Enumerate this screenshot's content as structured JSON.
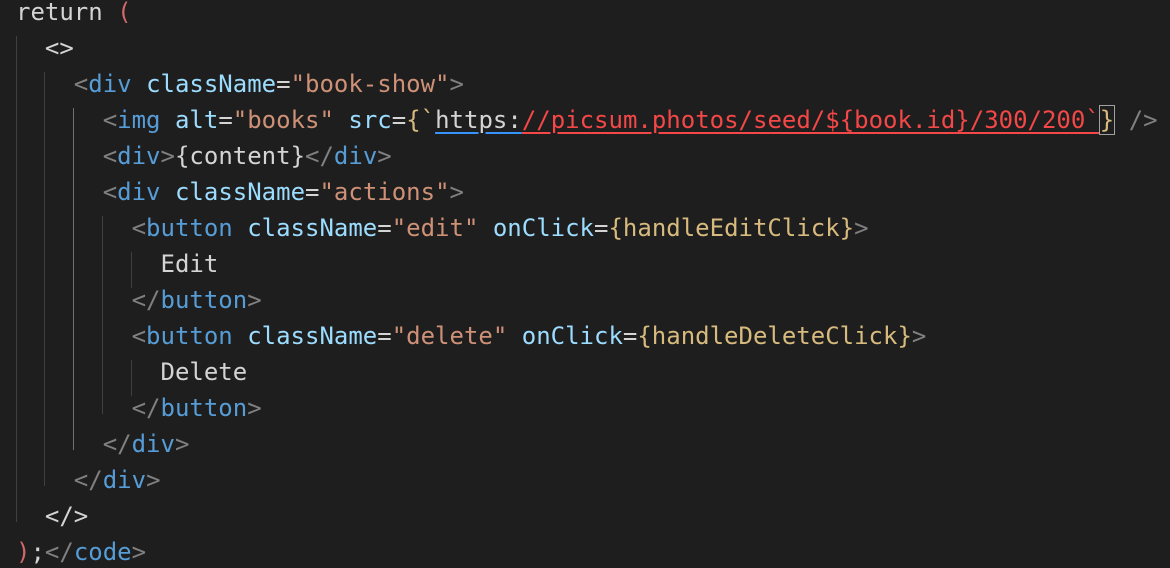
{
  "editor": {
    "lines": [
      {
        "parts": [
          {
            "t": "return",
            "c": "t-kw"
          },
          {
            "t": " ",
            "c": ""
          },
          {
            "t": "(",
            "c": "t-paren"
          }
        ]
      },
      {
        "parts": [
          {
            "t": "  ",
            "c": ""
          },
          {
            "t": "<>",
            "c": "t-ident"
          }
        ]
      },
      {
        "parts": [
          {
            "t": "    ",
            "c": ""
          },
          {
            "t": "<",
            "c": "t-punct"
          },
          {
            "t": "div",
            "c": "t-tag"
          },
          {
            "t": " ",
            "c": ""
          },
          {
            "t": "className",
            "c": "t-attr"
          },
          {
            "t": "=",
            "c": "t-ident"
          },
          {
            "t": "\"book-show\"",
            "c": "t-str"
          },
          {
            "t": ">",
            "c": "t-punct"
          }
        ]
      },
      {
        "parts": [
          {
            "t": "      ",
            "c": ""
          },
          {
            "t": "<",
            "c": "t-punct"
          },
          {
            "t": "img",
            "c": "t-tag"
          },
          {
            "t": " ",
            "c": ""
          },
          {
            "t": "alt",
            "c": "t-attr"
          },
          {
            "t": "=",
            "c": "t-ident"
          },
          {
            "t": "\"books\"",
            "c": "t-str"
          },
          {
            "t": " ",
            "c": ""
          },
          {
            "t": "src",
            "c": "t-attr"
          },
          {
            "t": "=",
            "c": "t-ident"
          },
          {
            "t": "{`",
            "c": "t-brace"
          },
          {
            "t": "https:",
            "c": "t-url"
          },
          {
            "t": "//picsum.photos/seed/${book.id}/300/200`",
            "c": "t-tmpl"
          },
          {
            "t": "}",
            "c": "t-bracket-match"
          },
          {
            "t": " ",
            "c": ""
          },
          {
            "t": "/>",
            "c": "t-punct"
          }
        ]
      },
      {
        "parts": [
          {
            "t": "      ",
            "c": ""
          },
          {
            "t": "<",
            "c": "t-punct"
          },
          {
            "t": "div",
            "c": "t-tag"
          },
          {
            "t": ">",
            "c": "t-punct"
          },
          {
            "t": "{content}",
            "c": "t-text"
          },
          {
            "t": "</",
            "c": "t-punct"
          },
          {
            "t": "div",
            "c": "t-tag"
          },
          {
            "t": ">",
            "c": "t-punct"
          }
        ]
      },
      {
        "parts": [
          {
            "t": "      ",
            "c": ""
          },
          {
            "t": "<",
            "c": "t-punct"
          },
          {
            "t": "div",
            "c": "t-tag"
          },
          {
            "t": " ",
            "c": ""
          },
          {
            "t": "className",
            "c": "t-attr"
          },
          {
            "t": "=",
            "c": "t-ident"
          },
          {
            "t": "\"actions\"",
            "c": "t-str"
          },
          {
            "t": ">",
            "c": "t-punct"
          }
        ]
      },
      {
        "parts": [
          {
            "t": "        ",
            "c": ""
          },
          {
            "t": "<",
            "c": "t-punct"
          },
          {
            "t": "button",
            "c": "t-tag"
          },
          {
            "t": " ",
            "c": ""
          },
          {
            "t": "className",
            "c": "t-attr"
          },
          {
            "t": "=",
            "c": "t-ident"
          },
          {
            "t": "\"edit\"",
            "c": "t-str"
          },
          {
            "t": " ",
            "c": ""
          },
          {
            "t": "onClick",
            "c": "t-attr"
          },
          {
            "t": "=",
            "c": "t-ident"
          },
          {
            "t": "{handleEditClick}",
            "c": "t-brace"
          },
          {
            "t": ">",
            "c": "t-punct"
          }
        ]
      },
      {
        "parts": [
          {
            "t": "          ",
            "c": ""
          },
          {
            "t": "Edit",
            "c": "t-text"
          }
        ]
      },
      {
        "parts": [
          {
            "t": "        ",
            "c": ""
          },
          {
            "t": "</",
            "c": "t-punct"
          },
          {
            "t": "button",
            "c": "t-tag"
          },
          {
            "t": ">",
            "c": "t-punct"
          }
        ]
      },
      {
        "parts": [
          {
            "t": "        ",
            "c": ""
          },
          {
            "t": "<",
            "c": "t-punct"
          },
          {
            "t": "button",
            "c": "t-tag"
          },
          {
            "t": " ",
            "c": ""
          },
          {
            "t": "className",
            "c": "t-attr"
          },
          {
            "t": "=",
            "c": "t-ident"
          },
          {
            "t": "\"delete\"",
            "c": "t-str"
          },
          {
            "t": " ",
            "c": ""
          },
          {
            "t": "onClick",
            "c": "t-attr"
          },
          {
            "t": "=",
            "c": "t-ident"
          },
          {
            "t": "{handleDeleteClick}",
            "c": "t-brace"
          },
          {
            "t": ">",
            "c": "t-punct"
          }
        ]
      },
      {
        "parts": [
          {
            "t": "          ",
            "c": ""
          },
          {
            "t": "Delete",
            "c": "t-text"
          }
        ]
      },
      {
        "parts": [
          {
            "t": "        ",
            "c": ""
          },
          {
            "t": "</",
            "c": "t-punct"
          },
          {
            "t": "button",
            "c": "t-tag"
          },
          {
            "t": ">",
            "c": "t-punct"
          }
        ]
      },
      {
        "parts": [
          {
            "t": "      ",
            "c": ""
          },
          {
            "t": "</",
            "c": "t-punct"
          },
          {
            "t": "div",
            "c": "t-tag"
          },
          {
            "t": ">",
            "c": "t-punct"
          }
        ]
      },
      {
        "parts": [
          {
            "t": "    ",
            "c": ""
          },
          {
            "t": "</",
            "c": "t-punct"
          },
          {
            "t": "div",
            "c": "t-tag"
          },
          {
            "t": ">",
            "c": "t-punct"
          }
        ]
      },
      {
        "parts": [
          {
            "t": "  ",
            "c": ""
          },
          {
            "t": "</>",
            "c": "t-ident"
          }
        ]
      },
      {
        "parts": [
          {
            "t": ")",
            "c": "t-paren"
          },
          {
            "t": ";",
            "c": "t-ident"
          },
          {
            "t": "</",
            "c": "t-punct"
          },
          {
            "t": "code",
            "c": "t-tag"
          },
          {
            "t": ">",
            "c": "t-punct"
          }
        ]
      }
    ]
  },
  "colors": {
    "background": "#1e1e1e",
    "tag": "#569cd6",
    "attribute": "#9cdcfe",
    "string": "#ce9178",
    "brace": "#d7ba7d",
    "error": "#f44747",
    "paren": "#d16969"
  }
}
